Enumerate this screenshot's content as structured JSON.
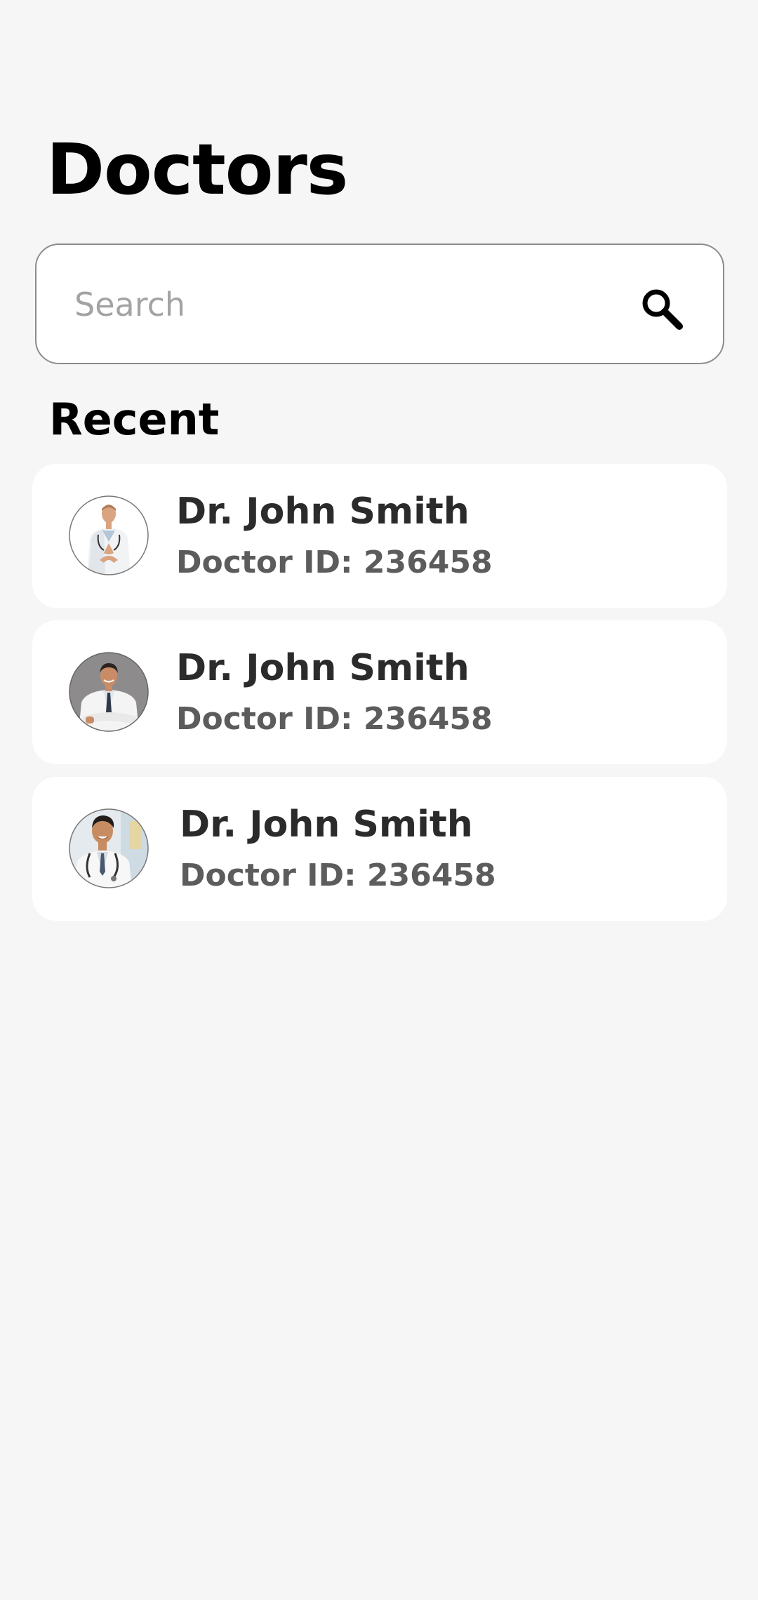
{
  "header": {
    "title": "Doctors"
  },
  "search": {
    "placeholder": "Search",
    "value": "",
    "icon": "search-icon"
  },
  "recent": {
    "title": "Recent",
    "doctors": [
      {
        "name": "Dr. John Smith",
        "id_text": "Doctor ID: 236458",
        "avatar": "doctor-photo"
      },
      {
        "name": "Dr. John Smith",
        "id_text": "Doctor ID: 236458",
        "avatar": "doctor-photo"
      },
      {
        "name": "Dr. John Smith",
        "id_text": "Doctor ID: 236458",
        "avatar": "doctor-photo"
      }
    ]
  },
  "colors": {
    "background": "#f6f6f6",
    "card": "#ffffff",
    "title_text": "#000000",
    "name_text": "#2b2b2b",
    "id_text": "#5c5c5c",
    "placeholder": "#a3a3a3",
    "border": "#8c8c8c"
  }
}
